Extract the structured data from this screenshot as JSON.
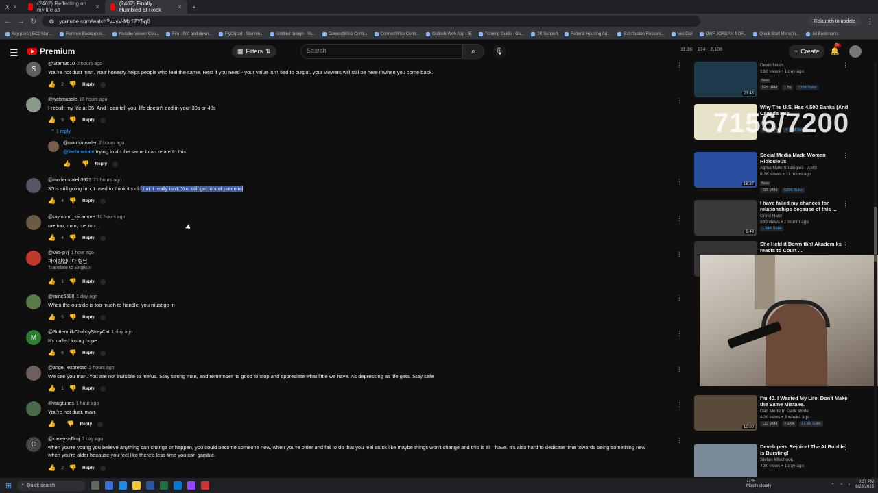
{
  "browser": {
    "tabs": [
      {
        "label": "X"
      },
      {
        "label": "(2462) Reflecting on my life aft"
      },
      {
        "label": "(2462) Finally Humbled at Rock"
      }
    ],
    "url": "youtube.com/watch?v=sV-Mz1ZY5q0",
    "relaunch_label": "Relaunch to update",
    "bookmarks": [
      "Key pairs | EC2 Man...",
      "Remove Backgroun...",
      "Youtube Viewer Cou...",
      "Fire - find and down...",
      "FlyClipart - Stunnin...",
      "Untitled design - Yo...",
      "ConnectWise Contr...",
      "ConnectWise Contr...",
      "Outlook Web App - IE",
      "Training Guide - Go...",
      "2K Support",
      "Federal Housing Ad...",
      "Satisfaction Researc...",
      "Vici Dial",
      "OWF JORDAN 4 OF...",
      "Quick Start Menu(lo...",
      "All Bookmarks"
    ]
  },
  "header": {
    "logo_text": "Premium",
    "filters_label": "Filters",
    "search_placeholder": "Search",
    "stats": [
      "11.1K",
      "174",
      "2,108"
    ],
    "create_label": "Create",
    "notif_count": "9+"
  },
  "comments": [
    {
      "avatar": "S",
      "avatar_color": "#5f5f5f",
      "user": "@Stam3610",
      "time": "2 hours ago",
      "text": "You're not dust man. Your honesty helps people who feel the same. Rest if you need - your value isn't tied to output. your viewers will still be here if/when you come back.",
      "likes": "2",
      "reply": "Reply"
    },
    {
      "avatar": "",
      "avatar_color": "#8a9a8a",
      "user": "@webmasale",
      "time": "10 hours ago",
      "text": "I rebuilt my life at 35. And I can tell you, life doesn't end in your 30s or 40s",
      "likes": "9",
      "reply": "Reply",
      "replies_label": "1 reply"
    },
    {
      "avatar": "",
      "avatar_color": "#7a5c4c",
      "user": "@matrixinvader",
      "time": "2 hours ago",
      "mention": "@webmasale",
      "text": " trying to do the same I can relate to this",
      "likes": "",
      "reply": "Reply"
    },
    {
      "avatar": "",
      "avatar_color": "#556",
      "user": "@moderncaleb3923",
      "time": "21 hours ago",
      "text_plain": "30 is still going bro, I used to think it's old",
      "text_hl": " but it really isn't. You still got lots of potential",
      "likes": "4",
      "reply": "Reply"
    },
    {
      "avatar": "",
      "avatar_color": "#6b5a45",
      "user": "@raymond_sycamore",
      "time": "10 hours ago",
      "text": "me too, man, me too...",
      "likes": "4",
      "reply": "Reply"
    },
    {
      "avatar": "",
      "avatar_color": "#c0392b",
      "user": "@085-p7j",
      "time": "1 hour ago",
      "text": "파이팅입니다 형님",
      "translate": "Translate to English",
      "likes": "1",
      "reply": "Reply"
    },
    {
      "avatar": "",
      "avatar_color": "#5a7a4a",
      "user": "@raine5508",
      "time": "1 day ago",
      "text": "When the outside is too much to handle, you must go in",
      "likes": "5",
      "reply": "Reply"
    },
    {
      "avatar": "M",
      "avatar_color": "#2e7d32",
      "user": "@ButtermilkChubbyStrayCat",
      "time": "1 day ago",
      "text": "It's called losing hope",
      "likes": "6",
      "reply": "Reply"
    },
    {
      "avatar": "",
      "avatar_color": "#6d5f5a",
      "user": "@angel_expresso",
      "time": "2 hours ago",
      "text": "We see you man. You are not invisible to me/us. Stay strong man, and remember its good to stop and appreciate what little we have. As depressing as life gets. Stay safe",
      "likes": "1",
      "reply": "Reply"
    },
    {
      "avatar": "",
      "avatar_color": "#4a6b4a",
      "user": "@mugtunes",
      "time": "1 hour ago",
      "text": "You're not dust, man.",
      "likes": "",
      "reply": "Reply"
    },
    {
      "avatar": "C",
      "avatar_color": "#444",
      "user": "@casey-zd5mj",
      "time": "1 day ago",
      "text": "when you're young you believe anything can change or happen, you could become someone new, when you're older and fail to do that you feel stuck like maybe things won't change and this is all I have. It's also hard to dedicate time towards being something new",
      "text2": "when you're older because you feel like there's less time you can gamble.",
      "likes": "2",
      "reply": "Reply"
    }
  ],
  "sidebar": [
    {
      "title": "",
      "channel": "Devin Nash",
      "meta": "13K views • 1 day ago",
      "new": "New",
      "vph": "525 VPH",
      "x": "1.5x",
      "subs": "133K Subs",
      "duration": "23:45",
      "thumb": "#1c3a4a"
    },
    {
      "title": "Why The U.S. Has 4,500 Banks (And Canada Has...",
      "channel": "",
      "meta": "",
      "new": "New",
      "vph": "5.4K VPH",
      "x": "",
      "subs": "4.07M Subs",
      "duration": "",
      "thumb": "#e8e2c8"
    },
    {
      "title": "Social Media Made Women Ridiculous",
      "channel": "Alpha Male Strategies - AMS",
      "meta": "8.3K views • 11 hours ago",
      "new": "New",
      "vph": "729 VPH",
      "x": "",
      "subs": "529K Subs",
      "duration": "18:37",
      "thumb": "#2a4fa0"
    },
    {
      "title": "I have failed my chances for relationships because of this ...",
      "channel": "Grind Hard",
      "meta": "939 views • 1 month ago",
      "new": "",
      "vph": "",
      "x": "",
      "subs": "1.64K Subs",
      "duration": "6:48",
      "thumb": "#3a3a3a"
    },
    {
      "title": "She Held it Down tbh! Akademiks reacts to Court ...",
      "channel": "",
      "meta": "",
      "new": "",
      "vph": "",
      "x": "",
      "subs": "",
      "duration": "",
      "thumb": "#333"
    },
    {
      "title": "I'm 40. I Wasted My Life. Don't Make the Same Mistake.",
      "channel": "Dad Mode In Dark Mode",
      "meta": "42K views • 3 weeks ago",
      "new": "",
      "vph": "133 VPH",
      "x": ">100x",
      "subs": "13.8K Subs",
      "duration": "10:00",
      "thumb": "#5a4a3a"
    },
    {
      "title": "Developers Rejoice! The AI Bubble is Bursting!",
      "channel": "Stefan Mischook",
      "meta": "42K views • 1 day ago",
      "new": "",
      "vph": "",
      "x": "",
      "subs": "",
      "duration": "",
      "thumb": "#7a8a9a"
    }
  ],
  "overlay_counter": "7156/7200",
  "taskbar": {
    "search_label": "Quick search",
    "weather_temp": "77°F",
    "weather_desc": "Mostly cloudy",
    "time": "9:37 PM",
    "date": "6/28/2025"
  }
}
